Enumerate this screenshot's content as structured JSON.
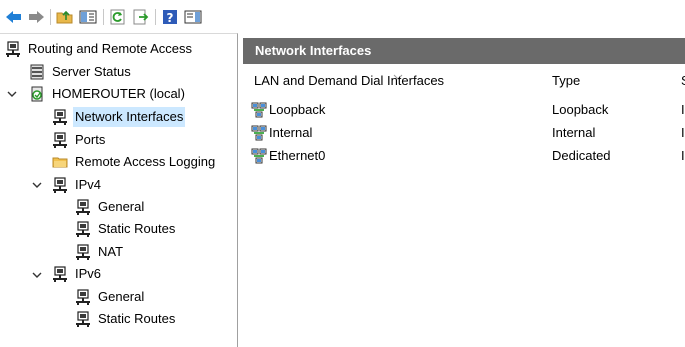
{
  "toolbar": {
    "buttons": [
      "back-icon",
      "forward-icon",
      "up-folder-icon",
      "show-hide-tree-icon",
      "refresh-icon",
      "export-list-icon",
      "help-icon",
      "action-pane-icon"
    ]
  },
  "tree": {
    "root": "Routing and Remote Access",
    "server_status": "Server Status",
    "server": "HOMEROUTER (local)",
    "network_interfaces": "Network Interfaces",
    "ports": "Ports",
    "remote_access_logging": "Remote Access Logging",
    "ipv4": "IPv4",
    "ipv4_general": "General",
    "ipv4_static_routes": "Static Routes",
    "ipv4_nat": "NAT",
    "ipv6": "IPv6",
    "ipv6_general": "General",
    "ipv6_static_routes": "Static Routes"
  },
  "details": {
    "title": "Network Interfaces",
    "columns": [
      "LAN and Demand Dial Interfaces",
      "Type",
      "S"
    ],
    "rows": [
      {
        "name": "Loopback",
        "type": "Loopback",
        "status": "I"
      },
      {
        "name": "Internal",
        "type": "Internal",
        "status": "I"
      },
      {
        "name": "Ethernet0",
        "type": "Dedicated",
        "status": "I"
      }
    ]
  },
  "colors": {
    "selection": "#cce8ff",
    "header_bar": "#6a6a6a"
  }
}
